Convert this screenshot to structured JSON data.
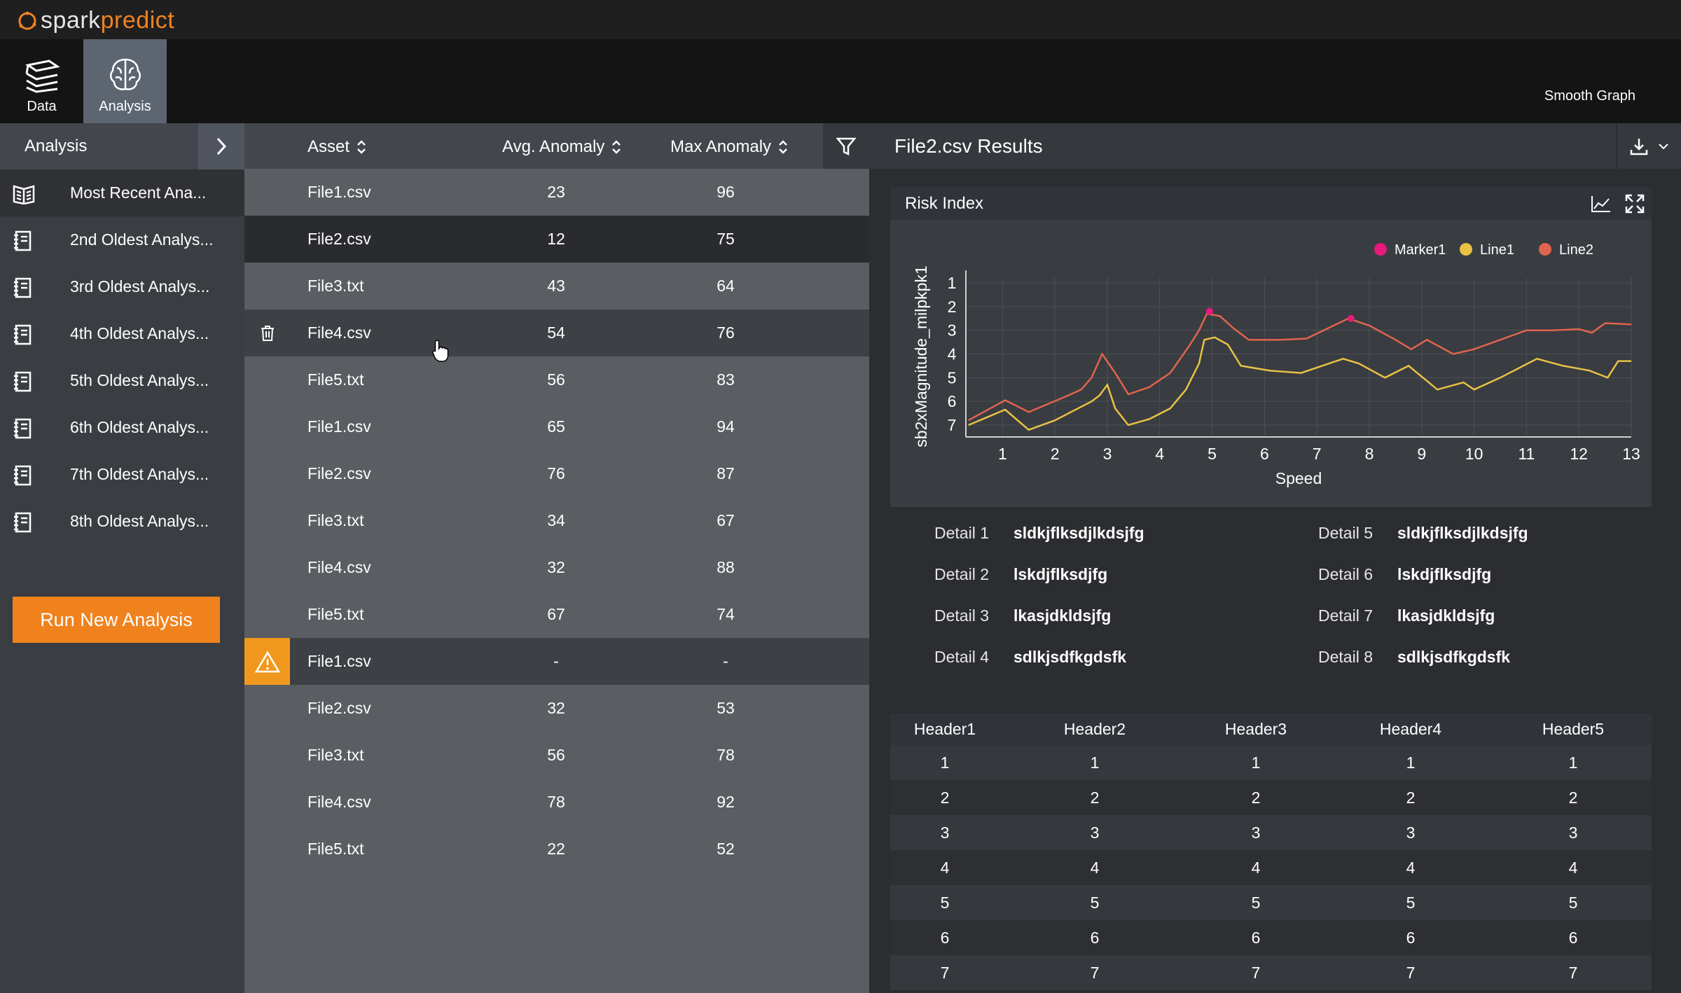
{
  "app": {
    "brand_a": "spark",
    "brand_b": "predict",
    "accent": "#f0821e"
  },
  "nav": {
    "data_label": "Data",
    "analysis_label": "Analysis",
    "smooth_graph": "Smooth Graph"
  },
  "sidebar": {
    "title": "Analysis",
    "items": [
      {
        "label": "Most Recent Ana..."
      },
      {
        "label": "2nd Oldest Analys..."
      },
      {
        "label": "3rd Oldest Analys..."
      },
      {
        "label": "4th Oldest Analys..."
      },
      {
        "label": "5th Oldest Analys..."
      },
      {
        "label": "6th Oldest Analys..."
      },
      {
        "label": "7th Oldest Analys..."
      },
      {
        "label": "8th Oldest Analys..."
      }
    ],
    "run_button": "Run New Analysis"
  },
  "files": {
    "headers": {
      "asset": "Asset",
      "avg": "Avg. Anomaly",
      "max": "Max Anomaly"
    },
    "rows": [
      {
        "asset": "File1.csv",
        "avg": "23",
        "max": "96"
      },
      {
        "asset": "File2.csv",
        "avg": "12",
        "max": "75"
      },
      {
        "asset": "File3.txt",
        "avg": "43",
        "max": "64"
      },
      {
        "asset": "File4.csv",
        "avg": "54",
        "max": "76"
      },
      {
        "asset": "File5.txt",
        "avg": "56",
        "max": "83"
      },
      {
        "asset": "File1.csv",
        "avg": "65",
        "max": "94"
      },
      {
        "asset": "File2.csv",
        "avg": "76",
        "max": "87"
      },
      {
        "asset": "File3.txt",
        "avg": "34",
        "max": "67"
      },
      {
        "asset": "File4.csv",
        "avg": "32",
        "max": "88"
      },
      {
        "asset": "File5.txt",
        "avg": "67",
        "max": "74"
      },
      {
        "asset": "File1.csv",
        "avg": "-",
        "max": "-"
      },
      {
        "asset": "File2.csv",
        "avg": "32",
        "max": "53"
      },
      {
        "asset": "File3.txt",
        "avg": "56",
        "max": "78"
      },
      {
        "asset": "File4.csv",
        "avg": "78",
        "max": "92"
      },
      {
        "asset": "File5.txt",
        "avg": "22",
        "max": "52"
      }
    ]
  },
  "results": {
    "title": "File2.csv Results",
    "chart_title": "Risk Index",
    "details": [
      {
        "k": "Detail 1",
        "v": "sldkjflksdjlkdsjfg"
      },
      {
        "k": "Detail 2",
        "v": "lskdjflksdjfg"
      },
      {
        "k": "Detail 3",
        "v": "lkasjdkldsjfg"
      },
      {
        "k": "Detail 4",
        "v": "sdlkjsdfkgdsfk"
      },
      {
        "k": "Detail 5",
        "v": "sldkjflksdjlkdsjfg"
      },
      {
        "k": "Detail 6",
        "v": "lskdjflksdjfg"
      },
      {
        "k": "Detail 7",
        "v": "lkasjdkldsjfg"
      },
      {
        "k": "Detail 8",
        "v": "sdlkjsdfkgdsfk"
      }
    ],
    "table": {
      "headers": [
        "Header1",
        "Header2",
        "Header3",
        "Header4",
        "Header5"
      ],
      "rows": [
        [
          "1",
          "1",
          "1",
          "1",
          "1"
        ],
        [
          "2",
          "2",
          "2",
          "2",
          "2"
        ],
        [
          "3",
          "3",
          "3",
          "3",
          "3"
        ],
        [
          "4",
          "4",
          "4",
          "4",
          "4"
        ],
        [
          "5",
          "5",
          "5",
          "5",
          "5"
        ],
        [
          "6",
          "6",
          "6",
          "6",
          "6"
        ],
        [
          "7",
          "7",
          "7",
          "7",
          "7"
        ]
      ]
    }
  },
  "chart_data": {
    "type": "line",
    "title": "Risk Index",
    "xlabel": "Speed",
    "ylabel": "sb2xMagnitude_milpkpk1",
    "xlim": [
      0.3,
      13
    ],
    "ylim": [
      7,
      1
    ],
    "x_ticks": [
      "1",
      "2",
      "3",
      "4",
      "5",
      "6",
      "7",
      "8",
      "9",
      "10",
      "11",
      "12",
      "13"
    ],
    "y_ticks": [
      "1",
      "2",
      "3",
      "4",
      "5",
      "6",
      "7"
    ],
    "grid": true,
    "legend_position": "top-right",
    "series": [
      {
        "name": "Marker1",
        "type": "scatter",
        "color": "#e8197d",
        "points": [
          [
            4.95,
            2.2
          ],
          [
            7.65,
            2.5
          ]
        ]
      },
      {
        "name": "Line1",
        "color": "#e8c245",
        "points": [
          [
            0.35,
            7.0
          ],
          [
            1.05,
            6.35
          ],
          [
            1.5,
            7.2
          ],
          [
            2.0,
            6.8
          ],
          [
            2.7,
            6.0
          ],
          [
            2.85,
            5.75
          ],
          [
            3.0,
            5.3
          ],
          [
            3.15,
            6.3
          ],
          [
            3.4,
            7.0
          ],
          [
            3.8,
            6.75
          ],
          [
            4.2,
            6.3
          ],
          [
            4.5,
            5.5
          ],
          [
            4.75,
            4.4
          ],
          [
            4.85,
            3.4
          ],
          [
            5.05,
            3.3
          ],
          [
            5.3,
            3.6
          ],
          [
            5.55,
            4.5
          ],
          [
            6.1,
            4.7
          ],
          [
            6.7,
            4.8
          ],
          [
            7.5,
            4.2
          ],
          [
            7.8,
            4.4
          ],
          [
            8.3,
            5.0
          ],
          [
            8.75,
            4.5
          ],
          [
            9.3,
            5.5
          ],
          [
            9.8,
            5.2
          ],
          [
            10.0,
            5.5
          ],
          [
            10.5,
            5.0
          ],
          [
            11.2,
            4.2
          ],
          [
            11.7,
            4.5
          ],
          [
            12.2,
            4.7
          ],
          [
            12.55,
            5.0
          ],
          [
            12.75,
            4.3
          ],
          [
            13.0,
            4.3
          ]
        ]
      },
      {
        "name": "Line2",
        "color": "#e0644e",
        "points": [
          [
            0.35,
            6.8
          ],
          [
            1.05,
            5.95
          ],
          [
            1.5,
            6.45
          ],
          [
            2.2,
            5.8
          ],
          [
            2.5,
            5.5
          ],
          [
            2.7,
            5.0
          ],
          [
            2.9,
            4.0
          ],
          [
            3.15,
            4.8
          ],
          [
            3.4,
            5.7
          ],
          [
            3.8,
            5.4
          ],
          [
            4.2,
            4.8
          ],
          [
            4.55,
            3.7
          ],
          [
            4.75,
            3.0
          ],
          [
            4.9,
            2.3
          ],
          [
            5.15,
            2.4
          ],
          [
            5.4,
            2.9
          ],
          [
            5.7,
            3.4
          ],
          [
            6.3,
            3.4
          ],
          [
            6.8,
            3.35
          ],
          [
            7.6,
            2.5
          ],
          [
            8.0,
            2.8
          ],
          [
            8.5,
            3.4
          ],
          [
            8.8,
            3.8
          ],
          [
            9.1,
            3.4
          ],
          [
            9.6,
            4.0
          ],
          [
            10.0,
            3.8
          ],
          [
            10.5,
            3.4
          ],
          [
            11.0,
            3.0
          ],
          [
            11.5,
            3.0
          ],
          [
            12.0,
            2.95
          ],
          [
            12.25,
            3.1
          ],
          [
            12.5,
            2.7
          ],
          [
            13.0,
            2.75
          ]
        ]
      }
    ]
  }
}
